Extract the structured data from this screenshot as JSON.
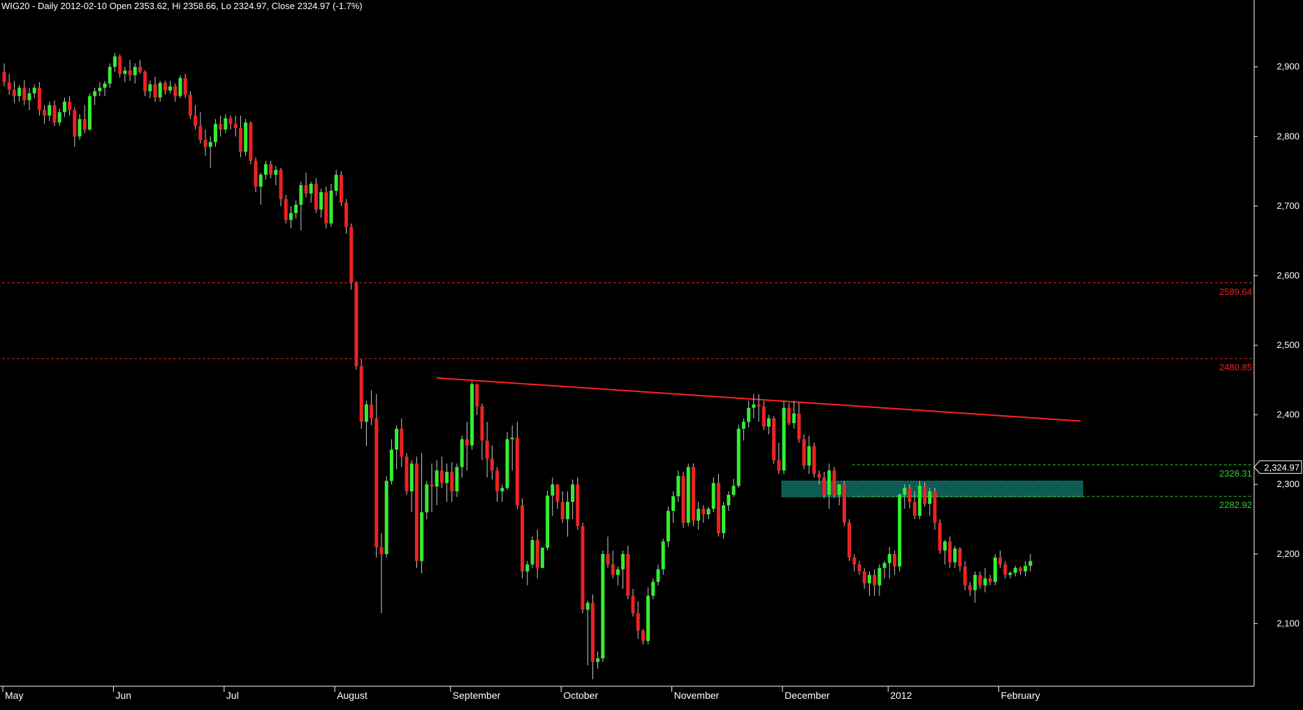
{
  "title": "WIG20 - Daily 2012-02-10 Open 2353.62, Hi 2358.66, Lo 2324.97, Close 2324.97 (-1.7%)",
  "colors": {
    "background": "#000000",
    "up": "#33ee33",
    "down": "#ee2222",
    "wick": "#cccccc",
    "axis_text": "#ffffff",
    "resistance_line": "#ff2222",
    "level_red": "#ee2222",
    "level_green": "#33cc33",
    "zone_fill": "#0d5c55"
  },
  "chart_data": {
    "type": "candlestick",
    "ylim": [
      2010,
      2970
    ],
    "y_ticks": [
      {
        "value": 2100,
        "label": "2,100"
      },
      {
        "value": 2200,
        "label": "2,200"
      },
      {
        "value": 2300,
        "label": "2,300"
      },
      {
        "value": 2400,
        "label": "2,400"
      },
      {
        "value": 2500,
        "label": "2,500"
      },
      {
        "value": 2600,
        "label": "2,600"
      },
      {
        "value": 2700,
        "label": "2,700"
      },
      {
        "value": 2800,
        "label": "2,800"
      },
      {
        "value": 2900,
        "label": "2,900"
      }
    ],
    "x_labels": [
      {
        "index": 0,
        "label": "May"
      },
      {
        "index": 22,
        "label": "Jun"
      },
      {
        "index": 44,
        "label": "Jul"
      },
      {
        "index": 66,
        "label": "August"
      },
      {
        "index": 89,
        "label": "September"
      },
      {
        "index": 111,
        "label": "October"
      },
      {
        "index": 133,
        "label": "November"
      },
      {
        "index": 155,
        "label": "December"
      },
      {
        "index": 176,
        "label": "2012"
      },
      {
        "index": 198,
        "label": "February"
      }
    ],
    "last_price_label": "2,324.97",
    "last_price": 2324.97,
    "levels": [
      {
        "value": 2589.64,
        "label": "2589.64",
        "color": "red",
        "start_index": 0
      },
      {
        "value": 2480.85,
        "label": "2480.85",
        "color": "red",
        "start_index": 0
      },
      {
        "value": 2328.31,
        "label": "2328.31",
        "color": "green",
        "start_index": 169
      },
      {
        "value": 2282.92,
        "label": "2282.92",
        "color": "green",
        "start_index": 169
      }
    ],
    "zone": {
      "start_index": 155,
      "end_index": 214,
      "top": 2305,
      "bottom": 2282
    },
    "trendline": {
      "start_index": 86,
      "start_value": 2453,
      "end_index": 214,
      "end_value": 2391
    },
    "candles": [
      [
        2893,
        2905,
        2872,
        2878
      ],
      [
        2878,
        2890,
        2860,
        2867
      ],
      [
        2867,
        2880,
        2848,
        2858
      ],
      [
        2858,
        2874,
        2850,
        2870
      ],
      [
        2870,
        2881,
        2845,
        2852
      ],
      [
        2852,
        2870,
        2838,
        2862
      ],
      [
        2862,
        2875,
        2855,
        2870
      ],
      [
        2870,
        2878,
        2830,
        2838
      ],
      [
        2838,
        2845,
        2818,
        2830
      ],
      [
        2830,
        2850,
        2822,
        2845
      ],
      [
        2845,
        2852,
        2815,
        2820
      ],
      [
        2820,
        2840,
        2815,
        2835
      ],
      [
        2835,
        2856,
        2828,
        2850
      ],
      [
        2850,
        2858,
        2830,
        2838
      ],
      [
        2838,
        2842,
        2785,
        2800
      ],
      [
        2800,
        2832,
        2795,
        2825
      ],
      [
        2825,
        2845,
        2805,
        2810
      ],
      [
        2810,
        2862,
        2808,
        2858
      ],
      [
        2858,
        2870,
        2845,
        2865
      ],
      [
        2865,
        2878,
        2858,
        2870
      ],
      [
        2870,
        2880,
        2858,
        2876
      ],
      [
        2876,
        2905,
        2870,
        2900
      ],
      [
        2900,
        2920,
        2893,
        2915
      ],
      [
        2915,
        2918,
        2885,
        2890
      ],
      [
        2890,
        2900,
        2878,
        2895
      ],
      [
        2895,
        2910,
        2880,
        2888
      ],
      [
        2888,
        2905,
        2876,
        2900
      ],
      [
        2900,
        2910,
        2890,
        2893
      ],
      [
        2893,
        2895,
        2858,
        2865
      ],
      [
        2865,
        2880,
        2855,
        2875
      ],
      [
        2875,
        2886,
        2850,
        2856
      ],
      [
        2856,
        2880,
        2850,
        2877
      ],
      [
        2877,
        2880,
        2860,
        2866
      ],
      [
        2866,
        2880,
        2862,
        2872
      ],
      [
        2872,
        2876,
        2850,
        2858
      ],
      [
        2858,
        2888,
        2855,
        2884
      ],
      [
        2884,
        2890,
        2855,
        2860
      ],
      [
        2860,
        2865,
        2825,
        2830
      ],
      [
        2830,
        2845,
        2810,
        2815
      ],
      [
        2815,
        2835,
        2790,
        2795
      ],
      [
        2795,
        2810,
        2772,
        2785
      ],
      [
        2785,
        2800,
        2755,
        2792
      ],
      [
        2792,
        2825,
        2785,
        2818
      ],
      [
        2818,
        2830,
        2800,
        2810
      ],
      [
        2810,
        2832,
        2805,
        2826
      ],
      [
        2826,
        2830,
        2810,
        2818
      ],
      [
        2818,
        2830,
        2800,
        2812
      ],
      [
        2812,
        2830,
        2770,
        2778
      ],
      [
        2778,
        2825,
        2772,
        2820
      ],
      [
        2820,
        2822,
        2760,
        2765
      ],
      [
        2765,
        2770,
        2720,
        2728
      ],
      [
        2728,
        2748,
        2702,
        2745
      ],
      [
        2745,
        2765,
        2738,
        2760
      ],
      [
        2760,
        2765,
        2740,
        2745
      ],
      [
        2745,
        2758,
        2730,
        2752
      ],
      [
        2752,
        2755,
        2700,
        2710
      ],
      [
        2710,
        2716,
        2675,
        2680
      ],
      [
        2680,
        2700,
        2668,
        2690
      ],
      [
        2690,
        2708,
        2682,
        2702
      ],
      [
        2702,
        2735,
        2665,
        2730
      ],
      [
        2730,
        2748,
        2712,
        2718
      ],
      [
        2718,
        2735,
        2705,
        2732
      ],
      [
        2732,
        2740,
        2690,
        2695
      ],
      [
        2695,
        2725,
        2683,
        2720
      ],
      [
        2720,
        2728,
        2668,
        2675
      ],
      [
        2675,
        2732,
        2670,
        2722
      ],
      [
        2722,
        2752,
        2715,
        2745
      ],
      [
        2745,
        2750,
        2700,
        2705
      ],
      [
        2705,
        2710,
        2660,
        2670
      ],
      [
        2670,
        2675,
        2580,
        2590
      ],
      [
        2590,
        2592,
        2465,
        2470
      ],
      [
        2470,
        2480,
        2380,
        2390
      ],
      [
        2390,
        2420,
        2355,
        2415
      ],
      [
        2415,
        2435,
        2385,
        2395
      ],
      [
        2395,
        2430,
        2195,
        2210
      ],
      [
        2210,
        2230,
        2115,
        2200
      ],
      [
        2200,
        2312,
        2195,
        2305
      ],
      [
        2305,
        2365,
        2300,
        2350
      ],
      [
        2350,
        2385,
        2322,
        2380
      ],
      [
        2380,
        2395,
        2325,
        2340
      ],
      [
        2340,
        2345,
        2285,
        2290
      ],
      [
        2290,
        2335,
        2260,
        2330
      ],
      [
        2330,
        2340,
        2180,
        2190
      ],
      [
        2190,
        2345,
        2172,
        2260
      ],
      [
        2260,
        2305,
        2250,
        2300
      ],
      [
        2300,
        2330,
        2260,
        2297
      ],
      [
        2297,
        2335,
        2270,
        2320
      ],
      [
        2320,
        2340,
        2295,
        2302
      ],
      [
        2302,
        2330,
        2275,
        2318
      ],
      [
        2318,
        2332,
        2275,
        2290
      ],
      [
        2290,
        2330,
        2282,
        2325
      ],
      [
        2325,
        2370,
        2310,
        2365
      ],
      [
        2365,
        2390,
        2320,
        2356
      ],
      [
        2356,
        2448,
        2350,
        2444
      ],
      [
        2444,
        2445,
        2400,
        2412
      ],
      [
        2412,
        2416,
        2335,
        2363
      ],
      [
        2363,
        2390,
        2310,
        2337
      ],
      [
        2337,
        2356,
        2307,
        2320
      ],
      [
        2320,
        2325,
        2275,
        2290
      ],
      [
        2290,
        2300,
        2275,
        2295
      ],
      [
        2295,
        2375,
        2292,
        2365
      ],
      [
        2365,
        2385,
        2320,
        2367
      ],
      [
        2367,
        2390,
        2265,
        2270
      ],
      [
        2270,
        2280,
        2165,
        2175
      ],
      [
        2175,
        2190,
        2155,
        2185
      ],
      [
        2185,
        2225,
        2180,
        2220
      ],
      [
        2220,
        2235,
        2165,
        2180
      ],
      [
        2180,
        2210,
        2180,
        2209
      ],
      [
        2209,
        2291,
        2205,
        2284
      ],
      [
        2284,
        2310,
        2255,
        2300
      ],
      [
        2300,
        2300,
        2265,
        2275
      ],
      [
        2275,
        2290,
        2245,
        2250
      ],
      [
        2250,
        2290,
        2225,
        2275
      ],
      [
        2275,
        2307,
        2250,
        2300
      ],
      [
        2300,
        2310,
        2235,
        2240
      ],
      [
        2240,
        2245,
        2115,
        2120
      ],
      [
        2120,
        2133,
        2040,
        2130
      ],
      [
        2130,
        2142,
        2020,
        2045
      ],
      [
        2045,
        2060,
        2035,
        2050
      ],
      [
        2050,
        2205,
        2045,
        2200
      ],
      [
        2200,
        2225,
        2180,
        2185
      ],
      [
        2185,
        2205,
        2165,
        2170
      ],
      [
        2170,
        2182,
        2155,
        2178
      ],
      [
        2178,
        2205,
        2150,
        2200
      ],
      [
        2200,
        2212,
        2135,
        2140
      ],
      [
        2140,
        2150,
        2110,
        2115
      ],
      [
        2115,
        2132,
        2078,
        2090
      ],
      [
        2090,
        2092,
        2070,
        2075
      ],
      [
        2075,
        2152,
        2070,
        2140
      ],
      [
        2140,
        2165,
        2135,
        2160
      ],
      [
        2160,
        2185,
        2155,
        2178
      ],
      [
        2178,
        2222,
        2170,
        2218
      ],
      [
        2218,
        2268,
        2210,
        2262
      ],
      [
        2262,
        2290,
        2245,
        2283
      ],
      [
        2283,
        2320,
        2275,
        2312
      ],
      [
        2312,
        2318,
        2238,
        2245
      ],
      [
        2245,
        2330,
        2240,
        2325
      ],
      [
        2325,
        2330,
        2240,
        2248
      ],
      [
        2248,
        2275,
        2235,
        2265
      ],
      [
        2265,
        2270,
        2245,
        2257
      ],
      [
        2257,
        2268,
        2250,
        2265
      ],
      [
        2265,
        2310,
        2260,
        2302
      ],
      [
        2302,
        2315,
        2225,
        2230
      ],
      [
        2230,
        2275,
        2222,
        2270
      ],
      [
        2270,
        2290,
        2262,
        2285
      ],
      [
        2285,
        2308,
        2282,
        2298
      ],
      [
        2298,
        2386,
        2295,
        2380
      ],
      [
        2380,
        2395,
        2363,
        2390
      ],
      [
        2390,
        2420,
        2382,
        2410
      ],
      [
        2410,
        2430,
        2395,
        2415
      ],
      [
        2415,
        2430,
        2390,
        2412
      ],
      [
        2412,
        2420,
        2378,
        2383
      ],
      [
        2383,
        2400,
        2372,
        2395
      ],
      [
        2395,
        2398,
        2330,
        2335
      ],
      [
        2335,
        2360,
        2315,
        2320
      ],
      [
        2320,
        2420,
        2315,
        2410
      ],
      [
        2410,
        2417,
        2385,
        2388
      ],
      [
        2388,
        2420,
        2380,
        2402
      ],
      [
        2402,
        2418,
        2360,
        2365
      ],
      [
        2365,
        2372,
        2322,
        2327
      ],
      [
        2327,
        2370,
        2315,
        2355
      ],
      [
        2355,
        2360,
        2310,
        2315
      ],
      [
        2315,
        2320,
        2300,
        2310
      ],
      [
        2310,
        2318,
        2280,
        2285
      ],
      [
        2285,
        2330,
        2265,
        2320
      ],
      [
        2320,
        2325,
        2280,
        2285
      ],
      [
        2285,
        2295,
        2270,
        2300
      ],
      [
        2300,
        2305,
        2240,
        2245
      ],
      [
        2245,
        2250,
        2190,
        2195
      ],
      [
        2195,
        2200,
        2175,
        2185
      ],
      [
        2185,
        2190,
        2170,
        2175
      ],
      [
        2175,
        2180,
        2150,
        2158
      ],
      [
        2158,
        2175,
        2140,
        2170
      ],
      [
        2170,
        2178,
        2140,
        2155
      ],
      [
        2155,
        2185,
        2140,
        2180
      ],
      [
        2180,
        2190,
        2165,
        2187
      ],
      [
        2187,
        2210,
        2165,
        2200
      ],
      [
        2200,
        2205,
        2170,
        2182
      ],
      [
        2182,
        2287,
        2175,
        2285
      ],
      [
        2285,
        2300,
        2265,
        2295
      ],
      [
        2295,
        2300,
        2266,
        2275
      ],
      [
        2275,
        2290,
        2250,
        2255
      ],
      [
        2255,
        2305,
        2250,
        2298
      ],
      [
        2298,
        2303,
        2268,
        2272
      ],
      [
        2272,
        2295,
        2255,
        2290
      ],
      [
        2290,
        2295,
        2235,
        2245
      ],
      [
        2245,
        2250,
        2200,
        2205
      ],
      [
        2205,
        2220,
        2185,
        2218
      ],
      [
        2218,
        2225,
        2180,
        2188
      ],
      [
        2188,
        2212,
        2180,
        2208
      ],
      [
        2208,
        2210,
        2175,
        2182
      ],
      [
        2182,
        2190,
        2148,
        2155
      ],
      [
        2155,
        2160,
        2140,
        2148
      ],
      [
        2148,
        2175,
        2130,
        2170
      ],
      [
        2170,
        2175,
        2150,
        2155
      ],
      [
        2155,
        2180,
        2145,
        2165
      ],
      [
        2165,
        2170,
        2155,
        2160
      ],
      [
        2160,
        2200,
        2155,
        2195
      ],
      [
        2195,
        2205,
        2180,
        2185
      ],
      [
        2185,
        2190,
        2165,
        2170
      ],
      [
        2170,
        2175,
        2165,
        2173
      ],
      [
        2173,
        2183,
        2168,
        2180
      ],
      [
        2180,
        2182,
        2170,
        2175
      ],
      [
        2175,
        2190,
        2168,
        2183
      ],
      [
        2183,
        2200,
        2175,
        2190
      ]
    ]
  }
}
